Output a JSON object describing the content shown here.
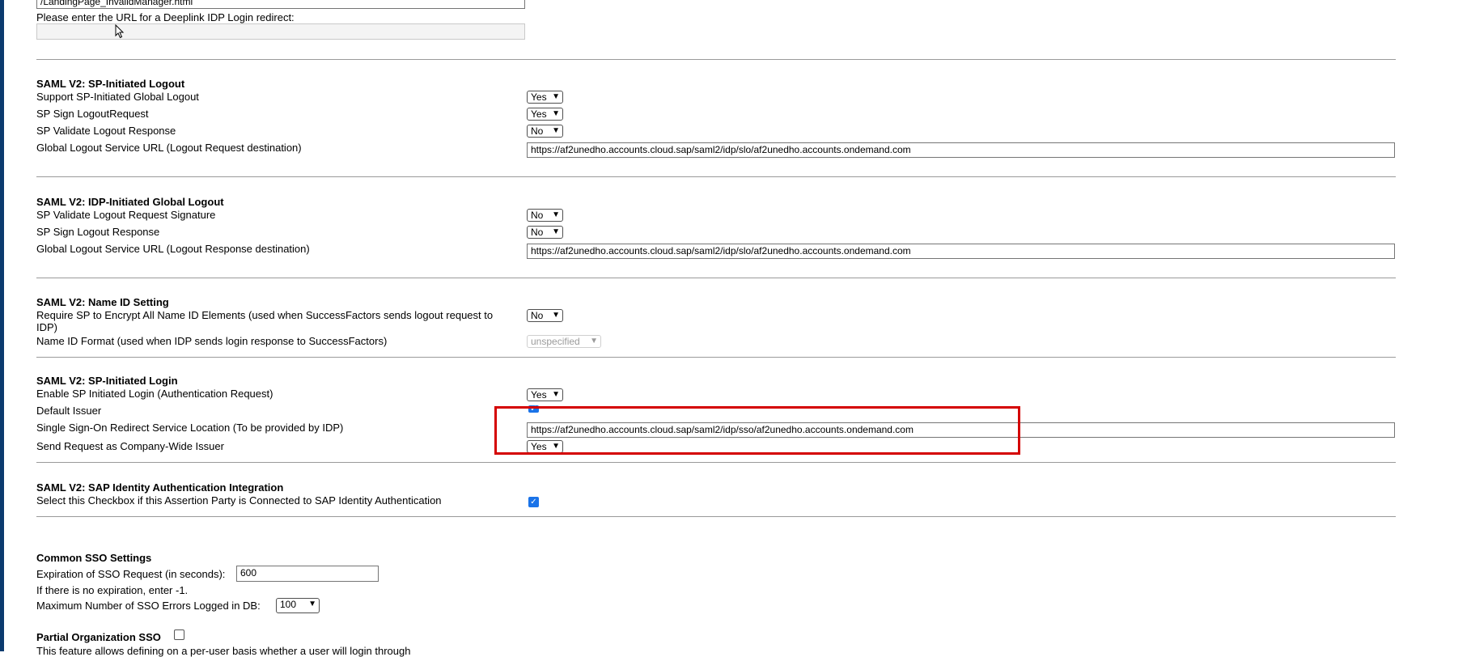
{
  "deeplink": {
    "prev_field_value": "/LandingPage_InvalidManager.html",
    "label": "Please enter the URL for a Deeplink IDP Login redirect:",
    "value": ""
  },
  "sp_logout": {
    "title": "SAML V2: SP-Initiated Logout",
    "rows": [
      {
        "label": "Support SP-Initiated Global Logout",
        "value": "Yes"
      },
      {
        "label": "SP Sign LogoutRequest",
        "value": "Yes"
      },
      {
        "label": "SP Validate Logout Response",
        "value": "No"
      }
    ],
    "url_label": "Global Logout Service URL (Logout Request destination)",
    "url_value": "https://af2unedho.accounts.cloud.sap/saml2/idp/slo/af2unedho.accounts.ondemand.com"
  },
  "idp_logout": {
    "title": "SAML V2: IDP-Initiated Global Logout",
    "rows": [
      {
        "label": "SP Validate Logout Request Signature",
        "value": "No"
      },
      {
        "label": "SP Sign Logout Response",
        "value": "No"
      }
    ],
    "url_label": "Global Logout Service URL (Logout Response destination)",
    "url_value": "https://af2unedho.accounts.cloud.sap/saml2/idp/slo/af2unedho.accounts.ondemand.com"
  },
  "name_id": {
    "title": "SAML V2: Name ID Setting",
    "encrypt_label": "Require SP to Encrypt All Name ID Elements (used when SuccessFactors sends logout request to IDP)",
    "encrypt_value": "No",
    "format_label": "Name ID Format (used when IDP sends login response to SuccessFactors)",
    "format_value": "unspecified"
  },
  "sp_login": {
    "title": "SAML V2: SP-Initiated Login",
    "enable_label": "Enable SP Initiated Login (Authentication Request)",
    "enable_value": "Yes",
    "default_issuer_label": "Default Issuer",
    "sso_label": "Single Sign-On Redirect Service Location (To be provided by IDP)",
    "sso_value": "https://af2unedho.accounts.cloud.sap/saml2/idp/sso/af2unedho.accounts.ondemand.com",
    "company_issuer_label": "Send Request as Company-Wide Issuer",
    "company_issuer_value": "Yes"
  },
  "sap_ias": {
    "title": "SAML V2: SAP Identity Authentication Integration",
    "checkbox_label": "Select this Checkbox if this Assertion Party is Connected to SAP Identity Authentication"
  },
  "common_sso": {
    "title": "Common SSO Settings",
    "expiration_label": "Expiration of SSO Request (in seconds):",
    "expiration_value": "600",
    "no_expiration_note": "If there is no expiration, enter -1.",
    "max_errors_label": "Maximum Number of SSO Errors Logged in DB:",
    "max_errors_value": "100"
  },
  "partial_org": {
    "title": "Partial Organization SSO",
    "description": "This feature allows defining on a per-user basis whether a user will login through"
  },
  "colors": {
    "highlight": "#d40000",
    "checkbox": "#1a73e8",
    "left_bar": "#0b3a6e"
  },
  "icons": {
    "chevron": "chevron-down-icon",
    "cursor": "mouse-cursor-icon",
    "check": "checkmark-icon"
  }
}
